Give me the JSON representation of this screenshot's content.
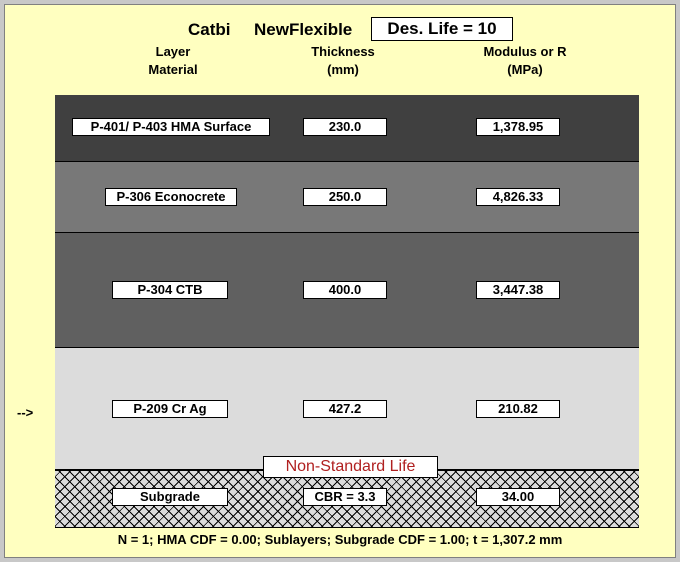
{
  "title": {
    "app": "Catbi",
    "module": "NewFlexible",
    "design_life": "Des. Life = 10"
  },
  "headers": {
    "layer_material": "Layer\nMaterial",
    "thickness": "Thickness\n(mm)",
    "modulus": "Modulus or R\n(MPa)"
  },
  "layers": [
    {
      "name": "P-401/ P-403 HMA Surface",
      "thickness": "230.0",
      "modulus": "1,378.95",
      "color": "#404040"
    },
    {
      "name": "P-306 Econocrete",
      "thickness": "250.0",
      "modulus": "4,826.33",
      "color": "#787878"
    },
    {
      "name": "P-304 CTB",
      "thickness": "400.0",
      "modulus": "3,447.38",
      "color": "#606060"
    },
    {
      "name": "P-209 Cr Ag",
      "thickness": "427.2",
      "modulus": "210.82",
      "color": "#dcdcdc"
    }
  ],
  "subgrade": {
    "name": "Subgrade",
    "cbr": "CBR = 3.3",
    "modulus": "34.00"
  },
  "arrow": "-->",
  "non_standard_label": "Non-Standard Life",
  "footer": "N = 1;  HMA CDF = 0.00;  Sublayers;  Subgrade CDF = 1.00;  t = 1,307.2 mm"
}
